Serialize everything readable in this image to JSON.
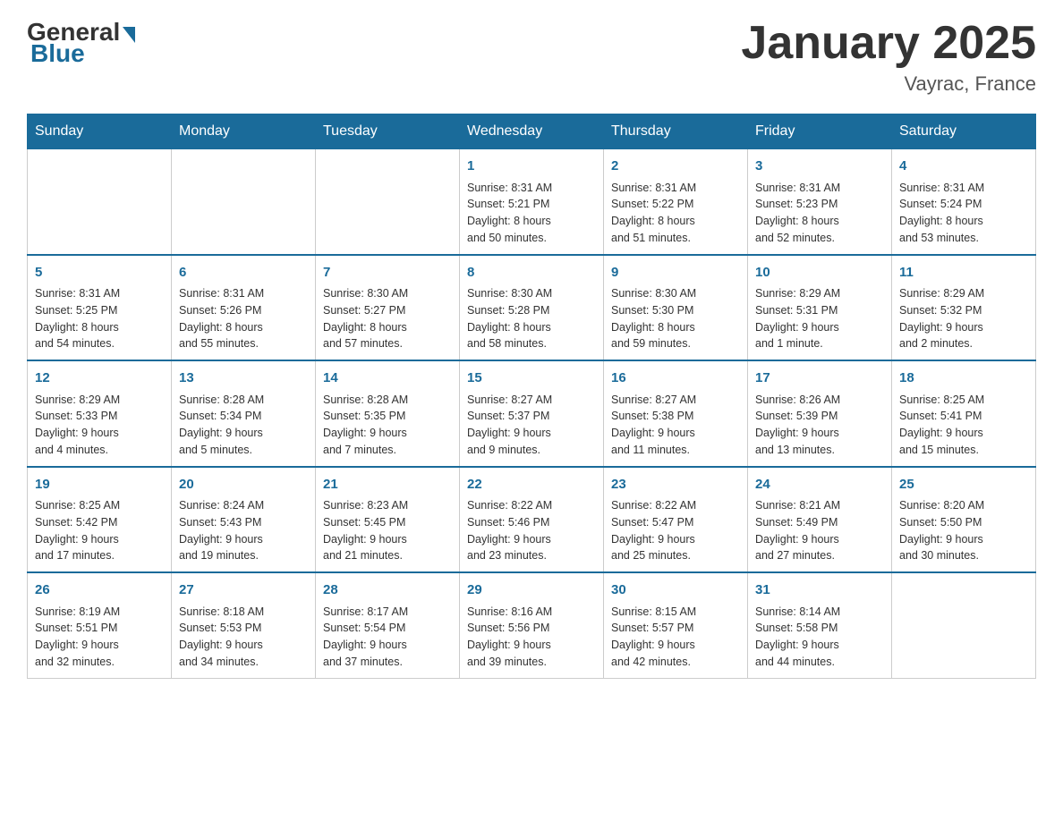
{
  "header": {
    "logo": {
      "general": "General",
      "blue": "Blue"
    },
    "title": "January 2025",
    "location": "Vayrac, France"
  },
  "weekdays": [
    "Sunday",
    "Monday",
    "Tuesday",
    "Wednesday",
    "Thursday",
    "Friday",
    "Saturday"
  ],
  "weeks": [
    [
      {
        "day": "",
        "info": ""
      },
      {
        "day": "",
        "info": ""
      },
      {
        "day": "",
        "info": ""
      },
      {
        "day": "1",
        "info": "Sunrise: 8:31 AM\nSunset: 5:21 PM\nDaylight: 8 hours\nand 50 minutes."
      },
      {
        "day": "2",
        "info": "Sunrise: 8:31 AM\nSunset: 5:22 PM\nDaylight: 8 hours\nand 51 minutes."
      },
      {
        "day": "3",
        "info": "Sunrise: 8:31 AM\nSunset: 5:23 PM\nDaylight: 8 hours\nand 52 minutes."
      },
      {
        "day": "4",
        "info": "Sunrise: 8:31 AM\nSunset: 5:24 PM\nDaylight: 8 hours\nand 53 minutes."
      }
    ],
    [
      {
        "day": "5",
        "info": "Sunrise: 8:31 AM\nSunset: 5:25 PM\nDaylight: 8 hours\nand 54 minutes."
      },
      {
        "day": "6",
        "info": "Sunrise: 8:31 AM\nSunset: 5:26 PM\nDaylight: 8 hours\nand 55 minutes."
      },
      {
        "day": "7",
        "info": "Sunrise: 8:30 AM\nSunset: 5:27 PM\nDaylight: 8 hours\nand 57 minutes."
      },
      {
        "day": "8",
        "info": "Sunrise: 8:30 AM\nSunset: 5:28 PM\nDaylight: 8 hours\nand 58 minutes."
      },
      {
        "day": "9",
        "info": "Sunrise: 8:30 AM\nSunset: 5:30 PM\nDaylight: 8 hours\nand 59 minutes."
      },
      {
        "day": "10",
        "info": "Sunrise: 8:29 AM\nSunset: 5:31 PM\nDaylight: 9 hours\nand 1 minute."
      },
      {
        "day": "11",
        "info": "Sunrise: 8:29 AM\nSunset: 5:32 PM\nDaylight: 9 hours\nand 2 minutes."
      }
    ],
    [
      {
        "day": "12",
        "info": "Sunrise: 8:29 AM\nSunset: 5:33 PM\nDaylight: 9 hours\nand 4 minutes."
      },
      {
        "day": "13",
        "info": "Sunrise: 8:28 AM\nSunset: 5:34 PM\nDaylight: 9 hours\nand 5 minutes."
      },
      {
        "day": "14",
        "info": "Sunrise: 8:28 AM\nSunset: 5:35 PM\nDaylight: 9 hours\nand 7 minutes."
      },
      {
        "day": "15",
        "info": "Sunrise: 8:27 AM\nSunset: 5:37 PM\nDaylight: 9 hours\nand 9 minutes."
      },
      {
        "day": "16",
        "info": "Sunrise: 8:27 AM\nSunset: 5:38 PM\nDaylight: 9 hours\nand 11 minutes."
      },
      {
        "day": "17",
        "info": "Sunrise: 8:26 AM\nSunset: 5:39 PM\nDaylight: 9 hours\nand 13 minutes."
      },
      {
        "day": "18",
        "info": "Sunrise: 8:25 AM\nSunset: 5:41 PM\nDaylight: 9 hours\nand 15 minutes."
      }
    ],
    [
      {
        "day": "19",
        "info": "Sunrise: 8:25 AM\nSunset: 5:42 PM\nDaylight: 9 hours\nand 17 minutes."
      },
      {
        "day": "20",
        "info": "Sunrise: 8:24 AM\nSunset: 5:43 PM\nDaylight: 9 hours\nand 19 minutes."
      },
      {
        "day": "21",
        "info": "Sunrise: 8:23 AM\nSunset: 5:45 PM\nDaylight: 9 hours\nand 21 minutes."
      },
      {
        "day": "22",
        "info": "Sunrise: 8:22 AM\nSunset: 5:46 PM\nDaylight: 9 hours\nand 23 minutes."
      },
      {
        "day": "23",
        "info": "Sunrise: 8:22 AM\nSunset: 5:47 PM\nDaylight: 9 hours\nand 25 minutes."
      },
      {
        "day": "24",
        "info": "Sunrise: 8:21 AM\nSunset: 5:49 PM\nDaylight: 9 hours\nand 27 minutes."
      },
      {
        "day": "25",
        "info": "Sunrise: 8:20 AM\nSunset: 5:50 PM\nDaylight: 9 hours\nand 30 minutes."
      }
    ],
    [
      {
        "day": "26",
        "info": "Sunrise: 8:19 AM\nSunset: 5:51 PM\nDaylight: 9 hours\nand 32 minutes."
      },
      {
        "day": "27",
        "info": "Sunrise: 8:18 AM\nSunset: 5:53 PM\nDaylight: 9 hours\nand 34 minutes."
      },
      {
        "day": "28",
        "info": "Sunrise: 8:17 AM\nSunset: 5:54 PM\nDaylight: 9 hours\nand 37 minutes."
      },
      {
        "day": "29",
        "info": "Sunrise: 8:16 AM\nSunset: 5:56 PM\nDaylight: 9 hours\nand 39 minutes."
      },
      {
        "day": "30",
        "info": "Sunrise: 8:15 AM\nSunset: 5:57 PM\nDaylight: 9 hours\nand 42 minutes."
      },
      {
        "day": "31",
        "info": "Sunrise: 8:14 AM\nSunset: 5:58 PM\nDaylight: 9 hours\nand 44 minutes."
      },
      {
        "day": "",
        "info": ""
      }
    ]
  ]
}
